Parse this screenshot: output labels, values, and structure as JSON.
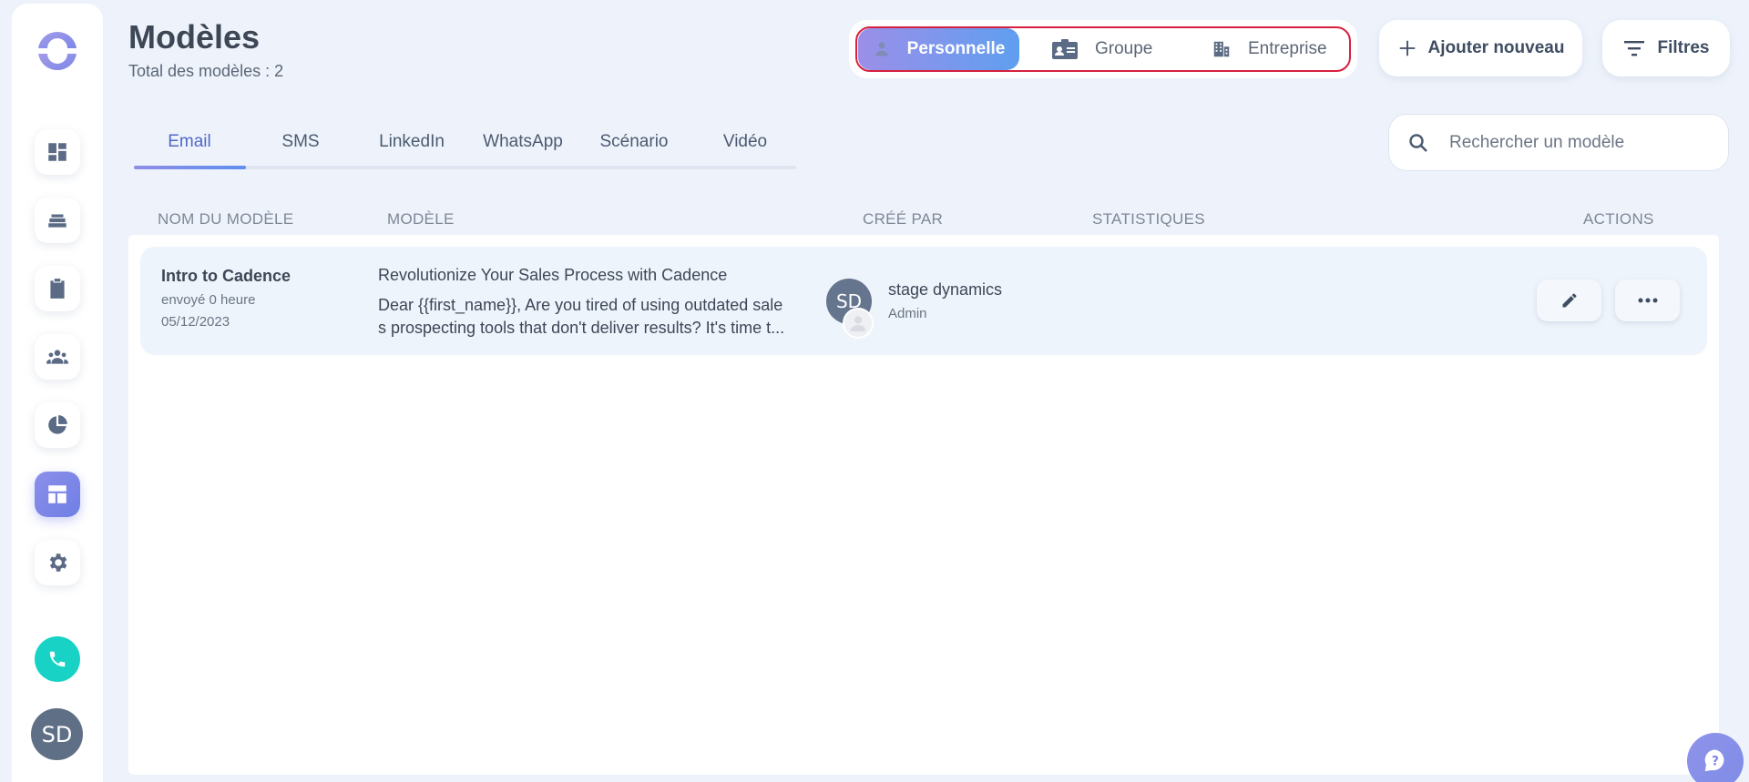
{
  "page": {
    "title": "Modèles",
    "subtitle": "Total des modèles : 2"
  },
  "scope": {
    "items": [
      {
        "label": "Personnelle",
        "icon": "person-icon",
        "active": true
      },
      {
        "label": "Groupe",
        "icon": "badge-icon",
        "active": false
      },
      {
        "label": "Entreprise",
        "icon": "building-icon",
        "active": false
      }
    ]
  },
  "header_buttons": {
    "add_label": "Ajouter nouveau",
    "filters_label": "Filtres"
  },
  "tabs": [
    {
      "label": "Email",
      "active": true
    },
    {
      "label": "SMS",
      "active": false
    },
    {
      "label": "LinkedIn",
      "active": false
    },
    {
      "label": "WhatsApp",
      "active": false
    },
    {
      "label": "Scénario",
      "active": false
    },
    {
      "label": "Vidéo",
      "active": false
    }
  ],
  "search": {
    "placeholder": "Rechercher un modèle"
  },
  "table": {
    "columns": [
      "NOM DU MODÈLE",
      "MODÈLE",
      "CRÉÉ PAR",
      "STATISTIQUES",
      "ACTIONS"
    ],
    "rows": [
      {
        "name": "Intro to Cadence",
        "sent": "envoyé 0 heure",
        "date": "05/12/2023",
        "subject": "Revolutionize Your Sales Process with Cadence",
        "body_line1": "Dear {{first_name}},   Are you tired of using outdated sale",
        "body_line2": "s prospecting tools that don't deliver results? It's time t...",
        "creator_initials": "SD",
        "creator_name": "stage dynamics",
        "creator_role": "Admin"
      }
    ]
  },
  "sidebar": {
    "items": [
      "dashboard-icon",
      "stack-icon",
      "clipboard-icon",
      "people-icon",
      "pie-chart-icon",
      "templates-icon",
      "settings-icon"
    ],
    "active_item": "templates-icon",
    "user_initials": "SD"
  },
  "colors": {
    "accent": "#6e7fe6",
    "highlight_border": "#d6203f",
    "phone": "#18d3c5"
  }
}
